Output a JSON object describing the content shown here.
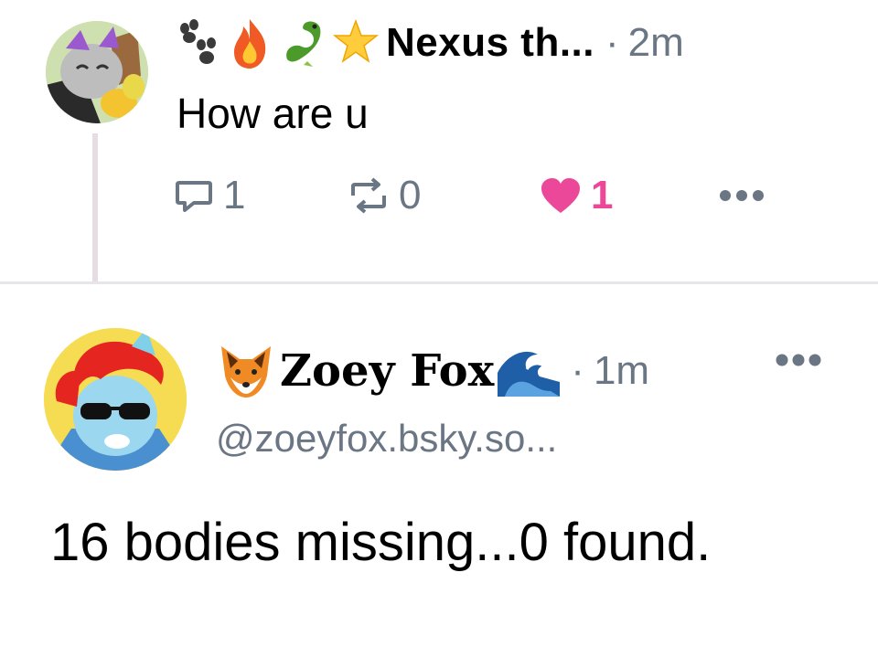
{
  "post1": {
    "author_name": "Nexus th...",
    "name_emojis": [
      "paw-prints",
      "fire",
      "dragon",
      "star"
    ],
    "separator": "·",
    "time": "2m",
    "text": "How are u",
    "reply_count": "1",
    "repost_count": "0",
    "like_count": "1",
    "liked": true
  },
  "post2": {
    "author_name": "Zoey Fox",
    "name_emojis": [
      "fox-face",
      "water-wave"
    ],
    "separator": "·",
    "time": "1m",
    "handle": "@zoeyfox.bsky.so...",
    "text": "16 bodies missing...0 found."
  },
  "colors": {
    "muted": "#6b7684",
    "like": "#ec4899",
    "thread_line": "#e6dde2",
    "divider": "#e6e6ea"
  }
}
